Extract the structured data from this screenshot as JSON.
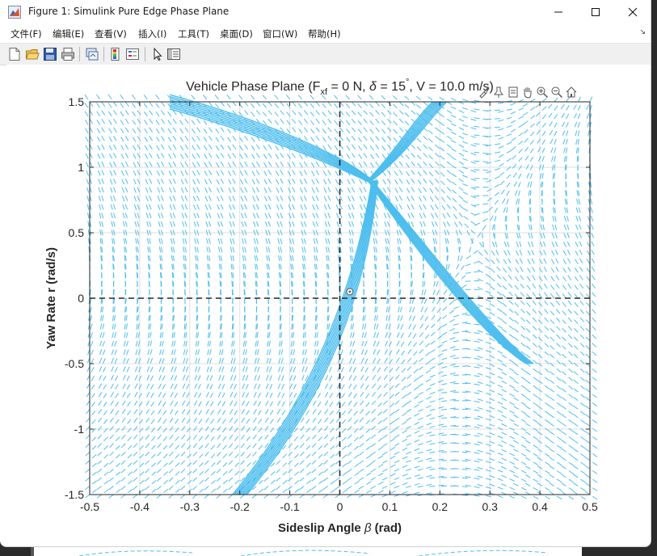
{
  "window": {
    "title": "Figure 1: Simulink Pure Edge Phase Plane",
    "controls": [
      "minimize",
      "maximize",
      "close"
    ]
  },
  "menubar": {
    "items": [
      "文件(F)",
      "编辑(E)",
      "查看(V)",
      "插入(I)",
      "工具(T)",
      "桌面(D)",
      "窗口(W)",
      "帮助(H)"
    ],
    "overflow_glyph": "↘"
  },
  "toolbar": {
    "icons": [
      "new-figure-icon",
      "open-file-icon",
      "save-icon",
      "print-icon",
      "link-plot-icon",
      "colorbar-icon",
      "legend-icon",
      "edit-plot-pointer-icon",
      "property-inspector-icon"
    ]
  },
  "axes_toolbar": {
    "icons": [
      "brush-icon",
      "data-tips-icon",
      "export-icon",
      "pan-icon",
      "zoom-in-icon",
      "zoom-out-icon",
      "home-icon"
    ]
  },
  "chart_data": {
    "type": "quiver",
    "title_parts": {
      "prefix": "Vehicle Phase Plane (F",
      "subscript": "xf",
      "middle": " = 0 N, ",
      "delta_symbol": "δ",
      "delta_value": " = 15",
      "degree_symbol": "°",
      "suffix": ", V = 10.0 m/s)"
    },
    "xlabel_prefix": "Sideslip Angle ",
    "xlabel_symbol": "β",
    "xlabel_suffix": " (rad)",
    "ylabel": "Yaw Rate r (rad/s)",
    "xlim": [
      -0.5,
      0.5
    ],
    "ylim": [
      -1.5,
      1.5
    ],
    "xticks": [
      "-0.5",
      "-0.4",
      "-0.3",
      "-0.2",
      "-0.1",
      "0",
      "0.1",
      "0.2",
      "0.3",
      "0.4",
      "0.5"
    ],
    "yticks": [
      "-1.5",
      "-1",
      "-0.5",
      "0",
      "0.5",
      "1",
      "1.5"
    ],
    "grid": true,
    "reference_lines": {
      "x": 0,
      "y": 0
    },
    "equilibrium_point": {
      "x": 0.02,
      "y": 0.05
    },
    "field_color": "#4dbeee",
    "separatrix_color": "#4dbeee"
  },
  "colors": {
    "window_bg": "#ffffff",
    "toolbar_bg": "#f0f0f0",
    "axis_color": "#262626",
    "grid_color": "#dfdfdf"
  }
}
